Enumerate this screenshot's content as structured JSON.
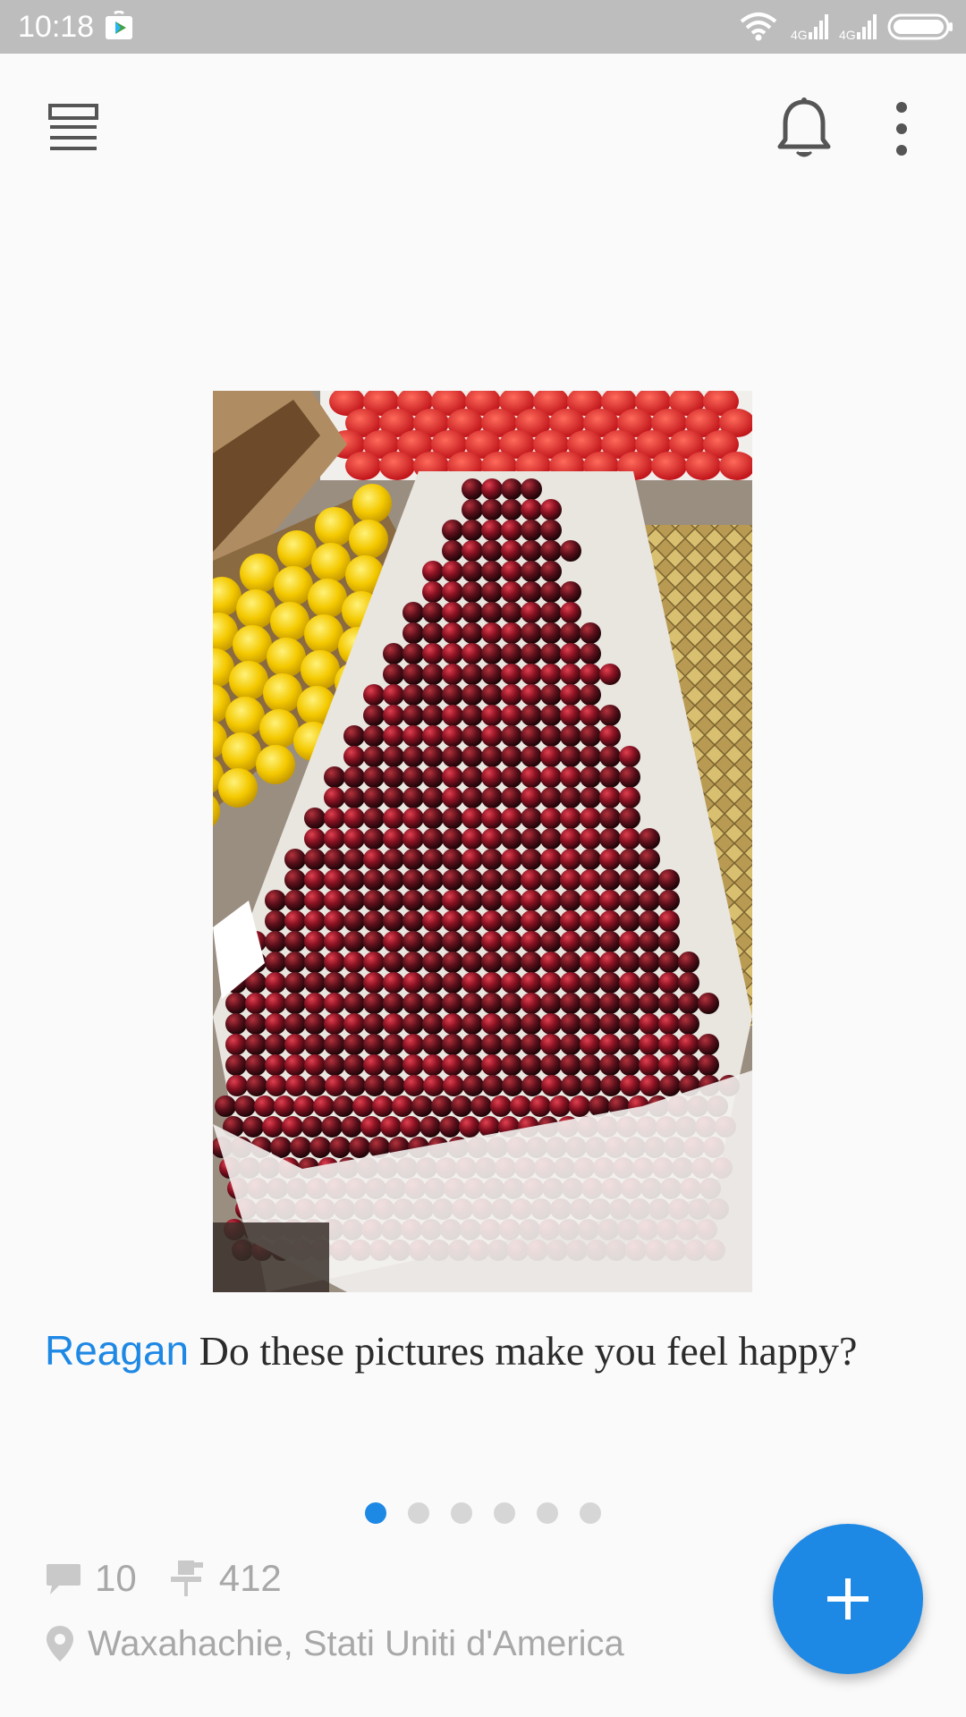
{
  "status_bar": {
    "time": "10:18",
    "icons": [
      "play-store-icon",
      "wifi-icon",
      "signal-icon",
      "signal-icon",
      "battery-icon"
    ]
  },
  "app_bar": {
    "icons": [
      "list-view-icon",
      "bell-icon",
      "more-vert-icon"
    ]
  },
  "post": {
    "image_subject": "cherries",
    "author": "Reagan",
    "text": "Do these pictures make you feel happy?",
    "pager": {
      "count": 6,
      "active_index": 0
    },
    "comments": "10",
    "likes": "412",
    "location": "Waxahachie, Stati Uniti d'America"
  },
  "colors": {
    "accent": "#1e88e5",
    "status_bar": "#bdbdbd",
    "background": "#fafafa",
    "muted_text": "#a8a8a8"
  },
  "fab": {
    "icon": "plus-icon"
  }
}
